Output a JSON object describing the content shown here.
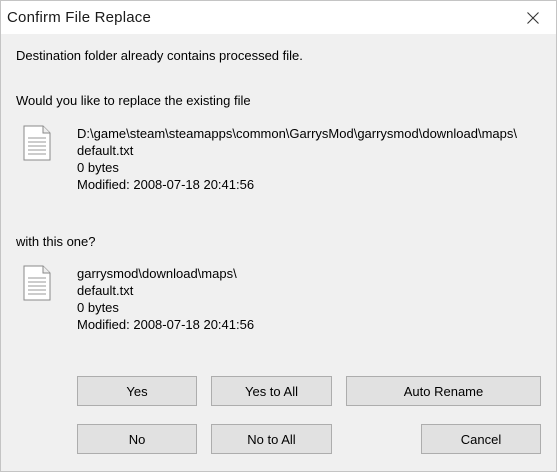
{
  "window": {
    "title": "Confirm File Replace"
  },
  "message": {
    "header": "Destination folder already contains processed file.",
    "question_existing": "Would you like to replace the existing file",
    "question_new": "with this one?"
  },
  "existing_file": {
    "icon": "document-icon",
    "path": "D:\\game\\steam\\steamapps\\common\\GarrysMod\\garrysmod\\download\\maps\\",
    "name": "default.txt",
    "size": "0 bytes",
    "modified": "Modified: 2008-07-18 20:41:56"
  },
  "new_file": {
    "icon": "document-icon",
    "path": "garrysmod\\download\\maps\\",
    "name": "default.txt",
    "size": "0 bytes",
    "modified": "Modified: 2008-07-18 20:41:56"
  },
  "buttons": {
    "yes": "Yes",
    "yes_to_all": "Yes to All",
    "auto_rename": "Auto Rename",
    "no": "No",
    "no_to_all": "No to All",
    "cancel": "Cancel"
  }
}
